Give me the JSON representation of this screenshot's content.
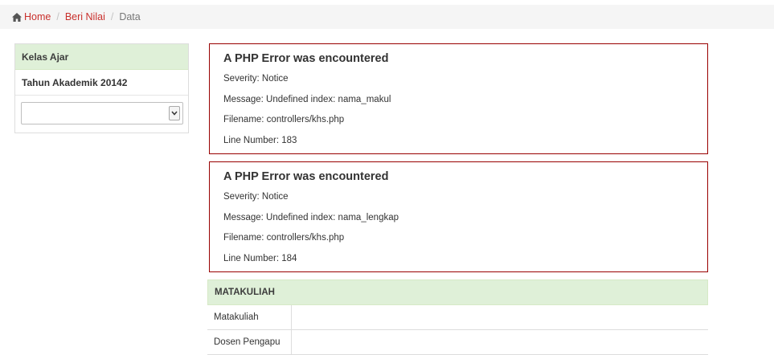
{
  "breadcrumb": {
    "home": "Home",
    "beri_nilai": "Beri Nilai",
    "current": "Data",
    "separator": "/"
  },
  "sidebar": {
    "heading": "Kelas Ajar",
    "academic_year": "Tahun Akademik 20142",
    "select_value": ""
  },
  "errors": [
    {
      "title": "A PHP Error was encountered",
      "severity": "Severity: Notice",
      "message": "Message: Undefined index: nama_makul",
      "filename": "Filename: controllers/khs.php",
      "line": "Line Number: 183"
    },
    {
      "title": "A PHP Error was encountered",
      "severity": "Severity: Notice",
      "message": "Message: Undefined index: nama_lengkap",
      "filename": "Filename: controllers/khs.php",
      "line": "Line Number: 184"
    }
  ],
  "matakuliah_panel": {
    "heading": "MATAKULIAH",
    "rows": [
      {
        "label": "Matakuliah",
        "value": ""
      },
      {
        "label": "Dosen Pengapu",
        "value": ""
      }
    ]
  },
  "colors": {
    "link": "#c9302c",
    "panel_heading_bg": "#dff0d8",
    "error_border": "#990000",
    "breadcrumb_bg": "#f5f5f5"
  },
  "icons": {
    "home": "home-icon",
    "select_arrow": "chevron-down-icon"
  }
}
